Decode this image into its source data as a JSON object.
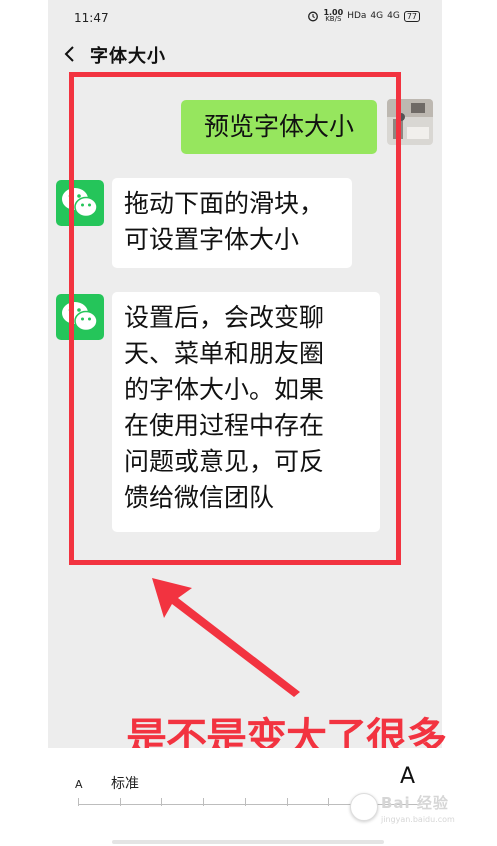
{
  "status_bar": {
    "time": "11:47",
    "speed_value": "1.00",
    "speed_unit": "KB/S",
    "hd": "HDa",
    "sig1": "4G",
    "sig2": "4G",
    "battery": "77"
  },
  "nav": {
    "title": "字体大小"
  },
  "chat": {
    "self_message": "预览字体大小",
    "bot_message_1": [
      "拖动下面的滑块，",
      "可设置字体大小"
    ],
    "bot_message_2": [
      "设置后，会改变聊",
      "天、菜单和朋友圈",
      "的字体大小。如果",
      "在使用过程中存在",
      "问题或意见，可反",
      "馈给微信团队"
    ]
  },
  "annotation": {
    "text": "是不是变大了很多"
  },
  "font_slider": {
    "small_label": "A",
    "standard_label": "标准",
    "large_label": "A",
    "steps": 8,
    "selected_step": 8
  },
  "watermark": {
    "main": "Bai 经验",
    "sub": "jingyan.baidu.com"
  },
  "colors": {
    "highlight": "#f23340",
    "self_bubble": "#96e65e",
    "wechat_green": "#25c55a"
  }
}
